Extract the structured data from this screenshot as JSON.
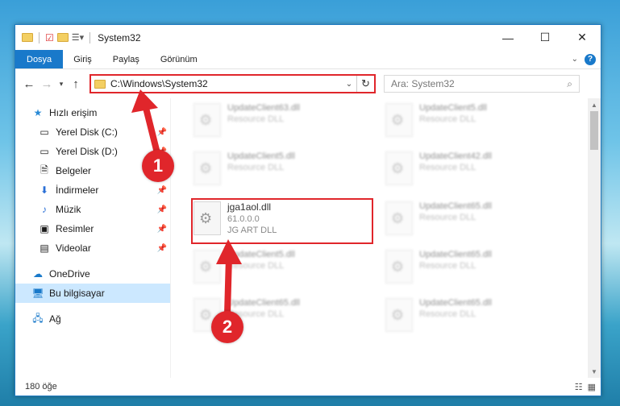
{
  "window": {
    "title": "System32"
  },
  "ribbon": {
    "tabs": [
      "Dosya",
      "Giriş",
      "Paylaş",
      "Görünüm"
    ]
  },
  "address": {
    "path": "C:\\Windows\\System32"
  },
  "search": {
    "placeholder": "Ara: System32"
  },
  "nav": {
    "quick_access": "Hızlı erişim",
    "items": [
      "Yerel Disk (C:)",
      "Yerel Disk (D:)",
      "Belgeler",
      "İndirmeler",
      "Müzik",
      "Resimler",
      "Videolar"
    ],
    "onedrive": "OneDrive",
    "this_pc": "Bu bilgisayar",
    "network": "Ağ"
  },
  "files": [
    {
      "name": "UpdateClient63.dll",
      "desc": "Resource DLL",
      "blurred": true
    },
    {
      "name": "UpdateClient5.dll",
      "desc": "Resource DLL",
      "blurred": true
    },
    {
      "name": "UpdateClient5.dll",
      "desc": "Resource DLL",
      "blurred": true
    },
    {
      "name": "UpdateClient42.dll",
      "desc": "Resource DLL",
      "blurred": true
    },
    {
      "name": "jga1aol.dll",
      "version": "61.0.0.0",
      "desc": "JG ART DLL",
      "blurred": false
    },
    {
      "name": "UpdateClient65.dll",
      "desc": "Resource DLL",
      "blurred": true
    },
    {
      "name": "UpdateClient5.dll",
      "desc": "Resource DLL",
      "blurred": true
    },
    {
      "name": "UpdateClient65.dll",
      "desc": "Resource DLL",
      "blurred": true
    },
    {
      "name": "UpdateClient65.dll",
      "desc": "Resource DLL",
      "blurred": true
    },
    {
      "name": "UpdateClient65.dll",
      "desc": "Resource DLL",
      "blurred": true
    }
  ],
  "status": {
    "count": "180 öğe"
  },
  "annotations": {
    "step1": "1",
    "step2": "2"
  },
  "colors": {
    "accent": "#1979ca",
    "highlight": "#e0262b"
  }
}
